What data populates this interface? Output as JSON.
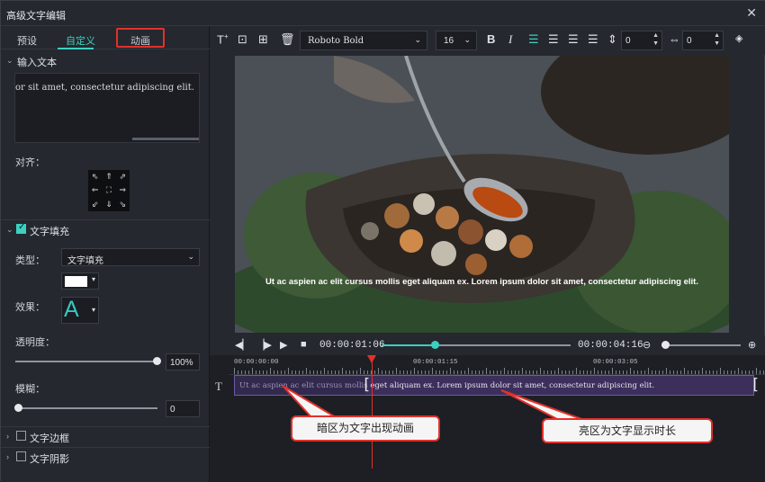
{
  "window": {
    "title": "高级文字编辑",
    "close": "✕"
  },
  "tabs": [
    {
      "label": "预设"
    },
    {
      "label": "自定义"
    },
    {
      "label": "动画"
    }
  ],
  "sections": {
    "input_text": {
      "label": "输入文本",
      "value": "or sit amet, consectetur adipiscing elit."
    },
    "align": {
      "label": "对齐：",
      "grid": [
        "⇖",
        "⇑",
        "⇗",
        "⇐",
        "⛶",
        "⇒",
        "⇙",
        "⇓",
        "⇘"
      ]
    },
    "text_fill": {
      "label": "文字填充",
      "checked": true,
      "type_label": "类型：",
      "type_value": "文字填充",
      "color": "#ffffff",
      "effect_label": "效果：",
      "effect_glyph": "A",
      "opacity_label": "透明度：",
      "opacity_value": "100%",
      "opacity_level": 1.0,
      "blur_label": "模糊：",
      "blur_value": "0",
      "blur_level": 0.0
    },
    "text_border": {
      "label": "文字边框",
      "checked": false
    },
    "text_shadow": {
      "label": "文字阴影",
      "checked": false
    }
  },
  "toolbar": {
    "icons": [
      "add-text-icon",
      "crop-icon",
      "add-image-icon",
      "delete-icon"
    ],
    "font": "Roboto Bold",
    "size": "16",
    "bold": "B",
    "italic": "I",
    "line_spacing": "0",
    "char_spacing": "0"
  },
  "preview": {
    "subtitle": "Ut ac aspien ac elit cursus mollis eget aliquam ex. Lorem ipsum dolor sit amet, consectetur adipiscing elit."
  },
  "transport": {
    "current_time": "00:00:01:06",
    "total_time": "00:00:04:16",
    "progress": 0.28,
    "zoom_level": 0.05
  },
  "timeline": {
    "ruler_labels": [
      "00:00:00:00",
      "00:00:01:15",
      "00:00:03:05"
    ],
    "clip_text_dim": "Ut ac aspien ac elit cursus mollis",
    "clip_text_bright": " eget aliquam ex. Lorem ipsum dolor sit amet, consectetur adipiscing elit."
  },
  "callouts": {
    "dark": "暗区为文字出现动画",
    "bright": "亮区为文字显示时长"
  },
  "colors": {
    "accent": "#3bd0c0",
    "highlight_red": "#e0312b",
    "clip": "#3c2f5b"
  }
}
